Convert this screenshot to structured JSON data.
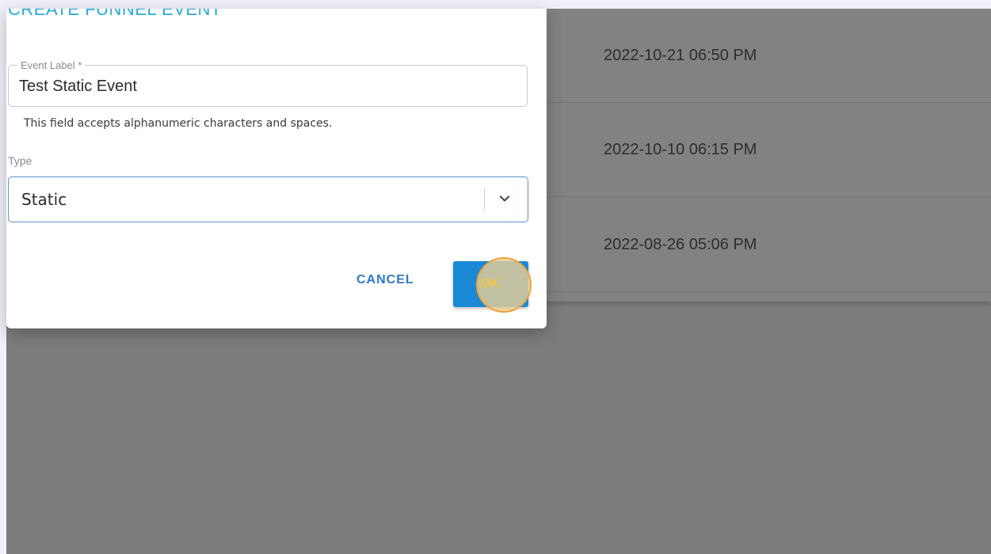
{
  "background_list": {
    "rows": [
      {
        "timestamp": "2022-10-21 06:50 PM"
      },
      {
        "timestamp": "2022-10-10 06:15 PM"
      },
      {
        "timestamp": "2022-08-26 05:06 PM"
      }
    ]
  },
  "dialog": {
    "title": "CREATE FUNNEL EVENT",
    "event_label": {
      "label": "Event Label *",
      "value": "Test Static Event",
      "helper": "This field accepts alphanumeric characters and spaces."
    },
    "type": {
      "label": "Type",
      "value": "Static"
    },
    "actions": {
      "cancel_label": "CANCEL",
      "ok_label": "OK"
    }
  },
  "colors": {
    "title": "#2aa8d8",
    "primary": "#1a8ad6",
    "backdrop": "#7c7c7c"
  }
}
